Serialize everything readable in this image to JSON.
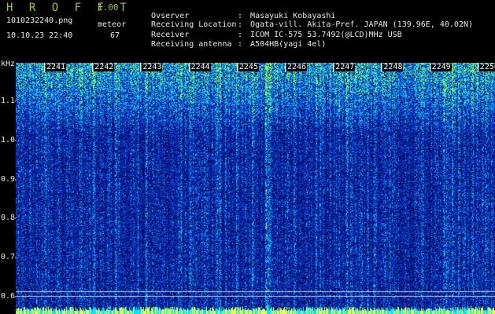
{
  "header": {
    "app_title": "H R O F F T",
    "app_version": "1.00",
    "file_name": "1010232240.png",
    "timestamp": "10.10.23 22:40",
    "meteor_label": "meteor",
    "meteor_count": "67"
  },
  "info": [
    {
      "label": "Ovserver",
      "value": "Masayuki Kobayashi"
    },
    {
      "label": "Receiving Location",
      "value": "Ogata-vill. Akita-Pref. JAPAN (139.96E, 40.02N)"
    },
    {
      "label": "Receiver",
      "value": "ICOM IC-575 53.7492(@LCD)MHz USB"
    },
    {
      "label": "Receiving antenna",
      "value": "A504HB(yagi 4el)"
    }
  ],
  "spectrogram": {
    "freq_unit": "kHz",
    "y_ticks": [
      "1.1",
      "1.0",
      "0.9",
      "0.8",
      "0.7",
      "0.6"
    ],
    "y_range_khz": [
      0.575,
      1.17
    ],
    "time_ticks": [
      "2241",
      "2242",
      "2243",
      "2244",
      "2245",
      "2246",
      "2247",
      "2248",
      "2249",
      "2250"
    ],
    "colors": {
      "background": "#000000",
      "noise_low": "#0a1a7a",
      "noise_mid": "#2848d8",
      "noise_high": "#00c8ff",
      "peak": "#9cff3c",
      "tick_label": "#ffffff",
      "marker_line": "#c0c0c0"
    }
  }
}
